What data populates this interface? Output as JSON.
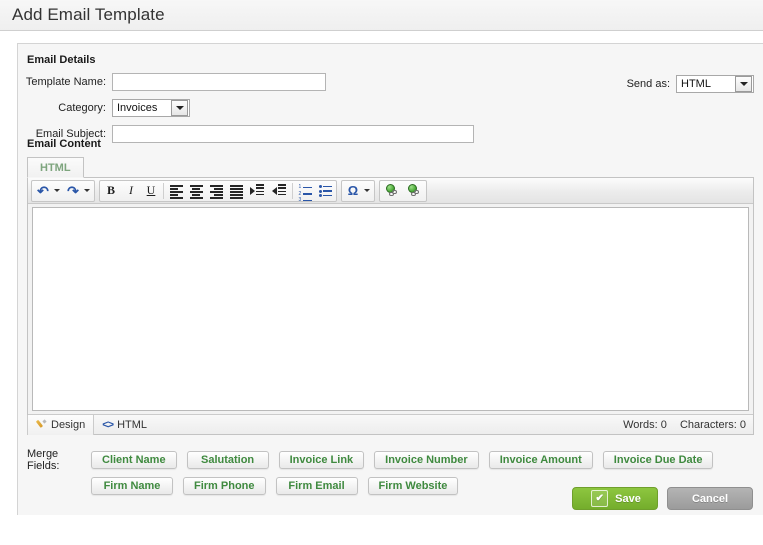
{
  "header": {
    "title": "Add Email Template"
  },
  "sections": {
    "email_details_label": "Email Details",
    "email_content_label": "Email Content"
  },
  "form": {
    "template_name": {
      "label": "Template Name:",
      "value": "",
      "placeholder": ""
    },
    "category": {
      "label": "Category:",
      "value": "Invoices",
      "options": [
        "Invoices"
      ]
    },
    "email_subject": {
      "label": "Email Subject:",
      "value": "",
      "placeholder": ""
    },
    "send_as": {
      "label": "Send as:",
      "value": "HTML",
      "options": [
        "HTML"
      ]
    }
  },
  "editor": {
    "tabs": [
      {
        "label": "HTML",
        "active": true
      }
    ],
    "toolbar": [
      {
        "name": "undo-icon",
        "glyph": "↶",
        "title": "Undo",
        "dropdown": true
      },
      {
        "name": "redo-icon",
        "glyph": "↷",
        "title": "Redo",
        "dropdown": true
      },
      {
        "name": "bold-icon",
        "glyph": "B",
        "title": "Bold"
      },
      {
        "name": "italic-icon",
        "glyph": "I",
        "title": "Italic"
      },
      {
        "name": "underline-icon",
        "glyph": "U",
        "title": "Underline"
      },
      {
        "name": "align-left-icon",
        "title": "Align Left"
      },
      {
        "name": "align-center-icon",
        "title": "Align Center"
      },
      {
        "name": "align-right-icon",
        "title": "Align Right"
      },
      {
        "name": "align-justify-icon",
        "title": "Justify"
      },
      {
        "name": "indent-increase-icon",
        "title": "Increase Indent"
      },
      {
        "name": "indent-decrease-icon",
        "title": "Decrease Indent"
      },
      {
        "name": "numbered-list-icon",
        "title": "Numbered List"
      },
      {
        "name": "bulleted-list-icon",
        "title": "Bulleted List"
      },
      {
        "name": "special-character-icon",
        "glyph": "Ω",
        "title": "Insert Special Character",
        "dropdown": true
      },
      {
        "name": "insert-link-icon",
        "title": "Insert Hyperlink"
      },
      {
        "name": "remove-link-icon",
        "title": "Remove Hyperlink"
      }
    ],
    "content": "",
    "modes": [
      {
        "name": "design",
        "label": "Design",
        "icon": "pencil-icon",
        "active": true
      },
      {
        "name": "html",
        "label": "HTML",
        "icon": "code-icon",
        "active": false
      }
    ],
    "status": {
      "words_label": "Words: 0",
      "characters_label": "Characters: 0"
    }
  },
  "merge_fields": {
    "label": "Merge Fields:",
    "rows": [
      [
        "Client Name",
        "Salutation",
        "Invoice Link",
        "Invoice Number",
        "Invoice Amount",
        "Invoice Due Date"
      ],
      [
        "Firm Name",
        "Firm Phone",
        "Firm Email",
        "Firm Website"
      ]
    ]
  },
  "footer": {
    "save_label": "Save",
    "save_icon": "✔",
    "cancel_label": "Cancel"
  },
  "colors": {
    "accent_green": "#8dc63f",
    "merge_text_green": "#3f8a3f",
    "cancel_gray": "#9b9b9b",
    "icon_blue": "#2a56a8"
  }
}
